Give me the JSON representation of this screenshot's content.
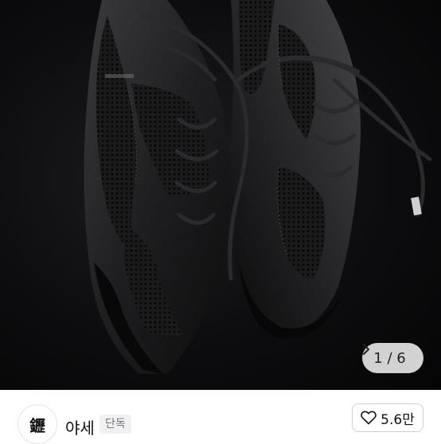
{
  "gallery": {
    "image_alt": "black sneakers",
    "counter": {
      "current": "1",
      "separator": "/",
      "total": "6",
      "next_icon": "chevron-right-icon"
    }
  },
  "seller": {
    "avatar_icon": "brand-logo-icon",
    "avatar_glyph": "䥶",
    "name": "야세",
    "badge": "단독"
  },
  "like": {
    "icon": "heart-outline-icon",
    "count": "5.6만"
  }
}
